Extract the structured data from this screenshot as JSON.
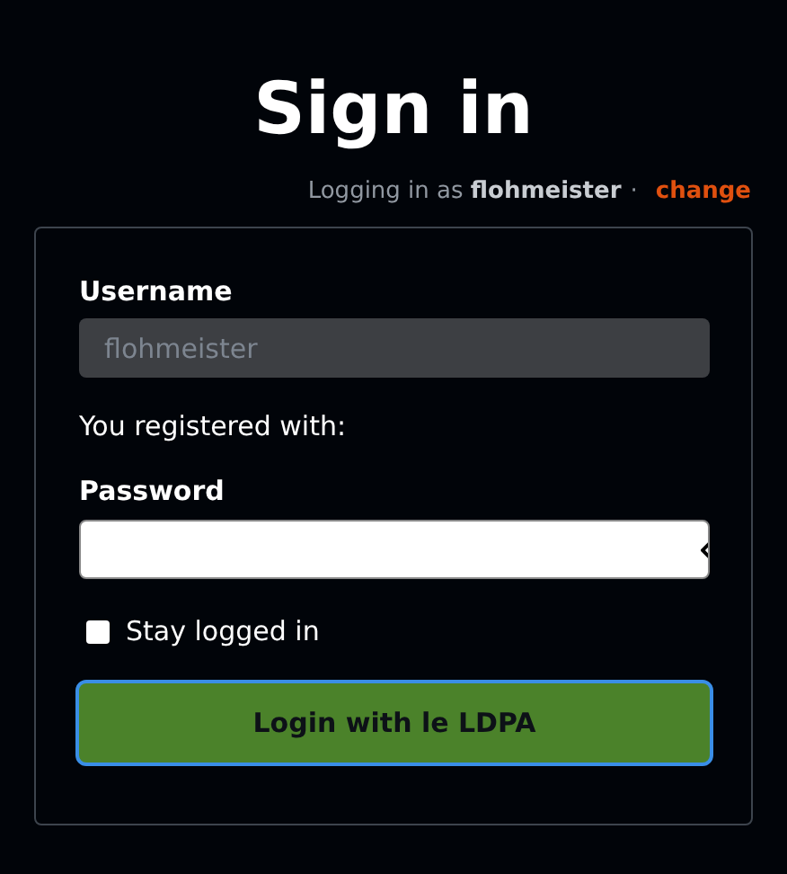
{
  "title": "Sign in",
  "login_status": {
    "prefix": "Logging in as",
    "user": "flohmeister",
    "separator": "·",
    "change_link": "change"
  },
  "form": {
    "username": {
      "label": "Username",
      "value": "flohmeister",
      "disabled": true
    },
    "registered_note": "You registered with:",
    "password": {
      "label": "Password"
    },
    "stay_logged_in": {
      "label": "Stay logged in",
      "checked": false
    },
    "submit_button": "Login with le LDPA"
  }
}
